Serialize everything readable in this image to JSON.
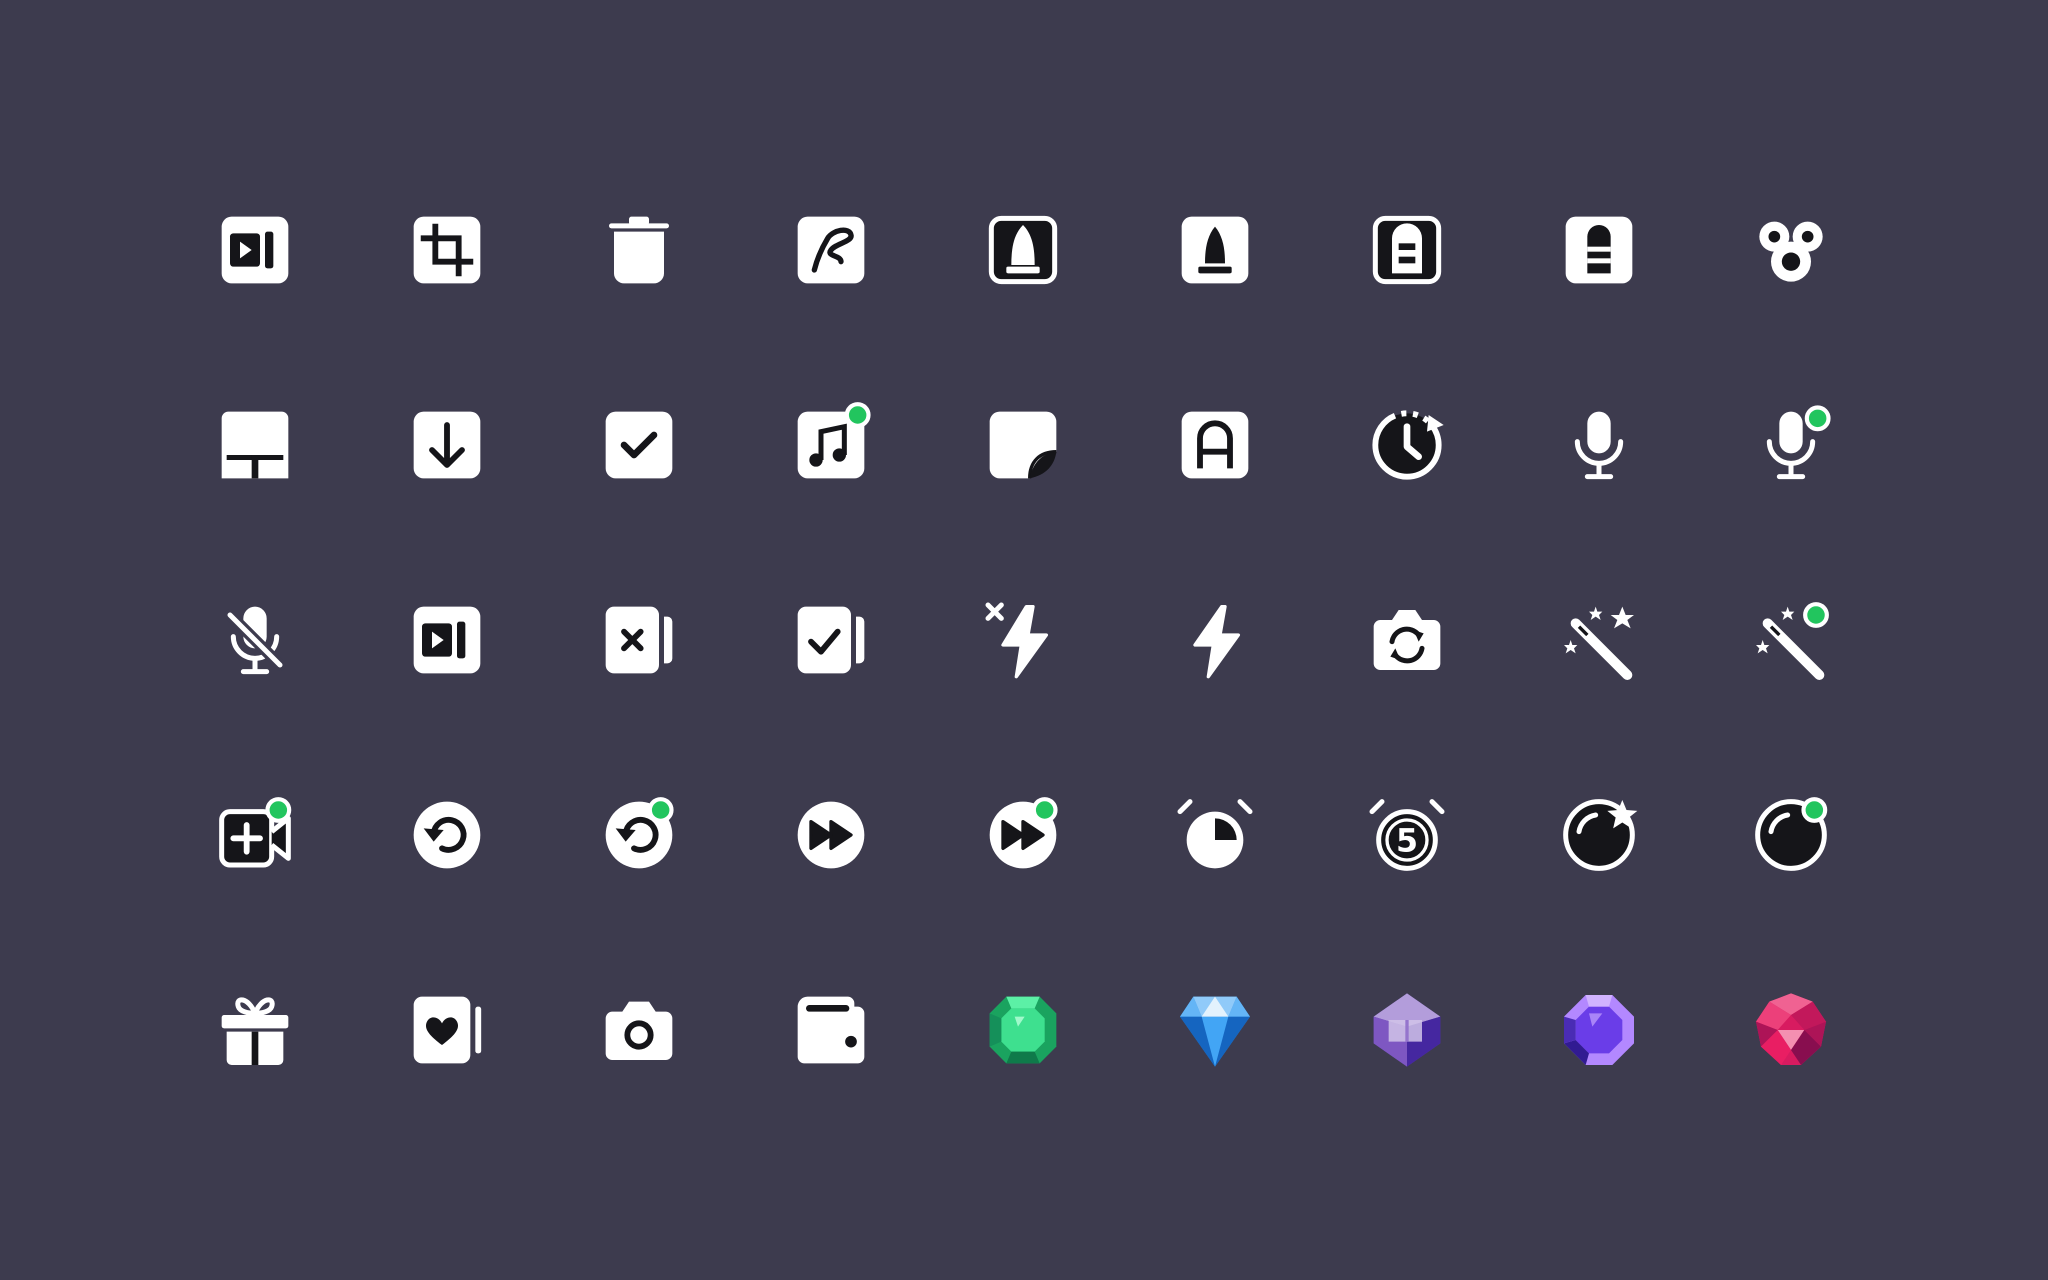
{
  "palette": {
    "background": "#3d3b4e",
    "icon": "#ffffff",
    "ink": "#151519",
    "badge": "#22c55e",
    "emerald": "#22c47a",
    "sapphire": "#2196f3",
    "amethyst": "#8b6fd6",
    "violet": "#7c4dff",
    "ruby": "#e91e63"
  },
  "rows": [
    [
      "video-sidebar-icon",
      "crop-icon",
      "trash-icon",
      "signature-icon",
      "rocket-outline-icon",
      "rocket-icon",
      "tower-outline-icon",
      "tower-icon",
      "group-circles-icon"
    ],
    [
      "tv-stand-icon",
      "download-icon",
      "checkbox-icon",
      "music-badge-icon",
      "sticker-icon",
      "text-a-icon",
      "timer-refresh-icon",
      "microphone-icon",
      "microphone-badge-icon"
    ],
    [
      "microphone-off-icon",
      "video-sidebar-icon",
      "card-close-icon",
      "card-check-icon",
      "flash-off-icon",
      "flash-icon",
      "camera-flip-icon",
      "magic-wand-icon",
      "magic-wand-badge-icon"
    ],
    [
      "video-add-badge-icon",
      "replay-icon",
      "replay-badge-icon",
      "fast-forward-icon",
      "fast-forward-badge-icon",
      "alarm-pie-icon",
      "alarm-five-icon",
      "orb-star-icon",
      "orb-badge-icon"
    ],
    [
      "gift-icon",
      "card-heart-icon",
      "camera-icon",
      "wallet-icon",
      "emerald-gem-icon",
      "sapphire-gem-icon",
      "amethyst-gem-icon",
      "violet-gem-icon",
      "ruby-gem-icon"
    ]
  ]
}
